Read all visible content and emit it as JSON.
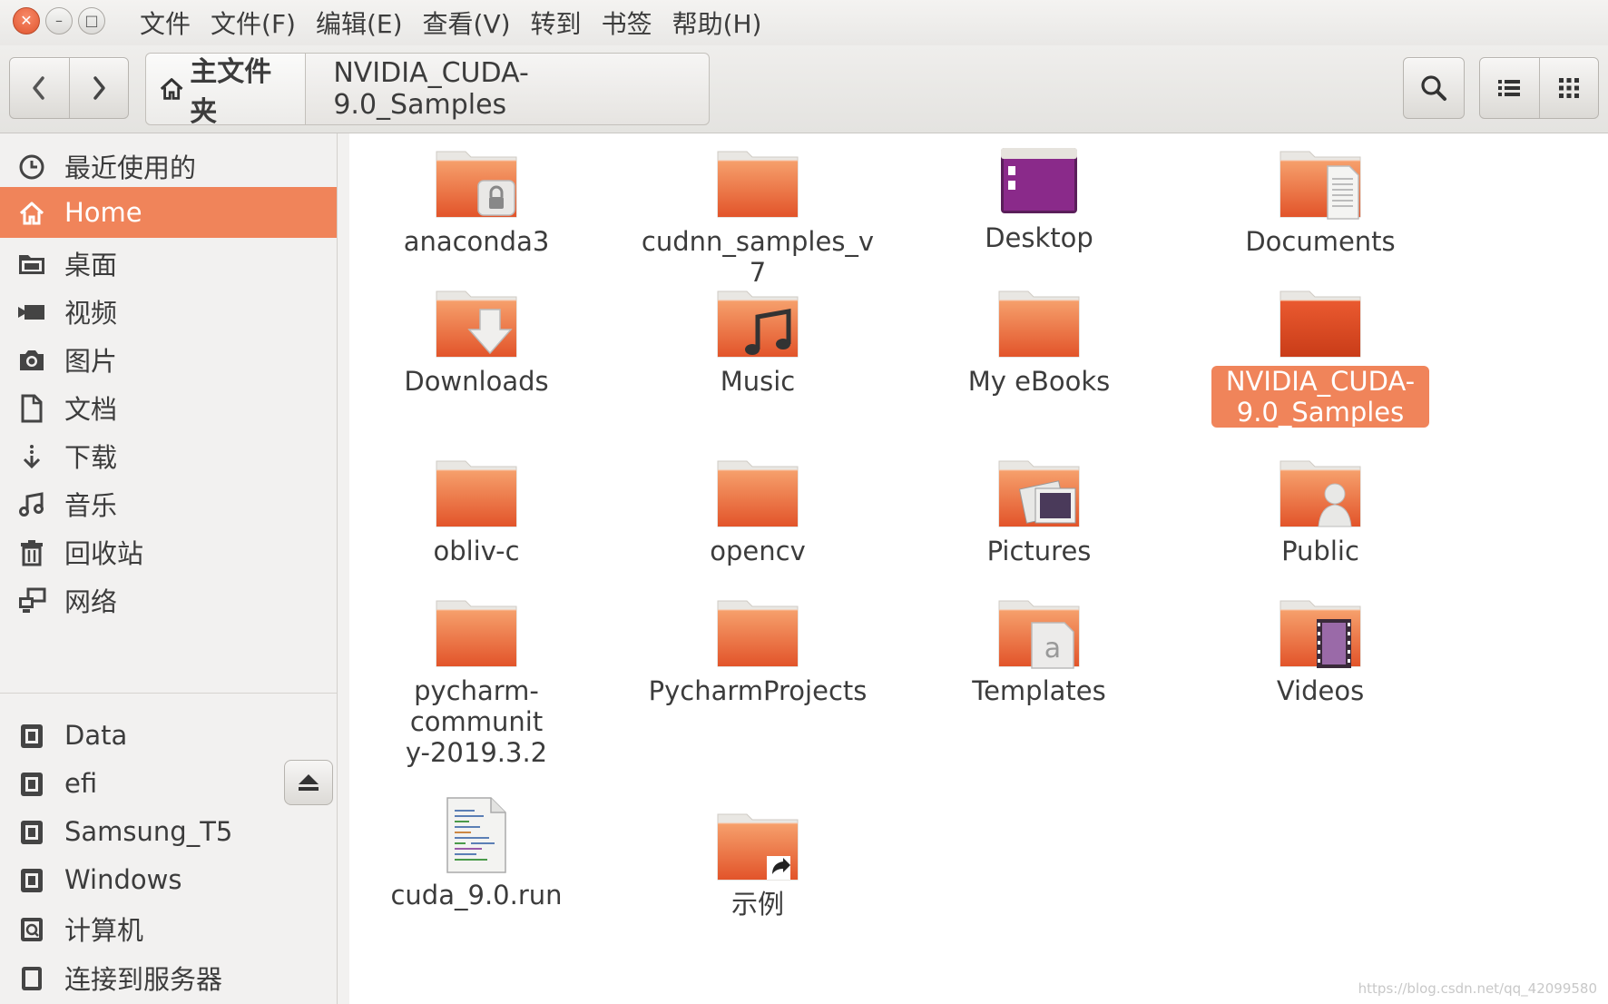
{
  "window": {
    "menus": [
      "文件",
      "文件(F)",
      "编辑(E)",
      "查看(V)",
      "转到",
      "书签",
      "帮助(H)"
    ]
  },
  "toolbar": {
    "breadcrumbs": [
      "主文件夹",
      "NVIDIA_CUDA-9.0_Samples"
    ]
  },
  "sidebar": {
    "places": [
      {
        "label": "最近使用的",
        "icon": "recent-clock-icon"
      },
      {
        "label": "Home",
        "icon": "home-icon",
        "active": true
      },
      {
        "label": "桌面",
        "icon": "desktop-folder-icon"
      },
      {
        "label": "视频",
        "icon": "video-camera-icon"
      },
      {
        "label": "图片",
        "icon": "camera-icon"
      },
      {
        "label": "文档",
        "icon": "document-icon"
      },
      {
        "label": "下载",
        "icon": "download-arrow-icon"
      },
      {
        "label": "音乐",
        "icon": "music-note-icon"
      },
      {
        "label": "回收站",
        "icon": "trash-icon"
      },
      {
        "label": "网络",
        "icon": "network-icon"
      }
    ],
    "devices": [
      {
        "label": "Data",
        "icon": "drive-icon"
      },
      {
        "label": "efi",
        "icon": "drive-icon"
      },
      {
        "label": "Samsung_T5",
        "icon": "drive-icon"
      },
      {
        "label": "Windows",
        "icon": "drive-icon"
      },
      {
        "label": "计算机",
        "icon": "computer-icon"
      },
      {
        "label": "连接到服务器",
        "icon": "server-icon"
      }
    ]
  },
  "files": [
    {
      "name": "anaconda3",
      "emblem": "lock"
    },
    {
      "name": "cudnn_samples_v7",
      "emblem": "none"
    },
    {
      "name": "Desktop",
      "emblem": "desktop"
    },
    {
      "name": "Documents",
      "emblem": "document"
    },
    {
      "name": "Downloads",
      "emblem": "download"
    },
    {
      "name": "Music",
      "emblem": "music"
    },
    {
      "name": "My eBooks",
      "emblem": "none"
    },
    {
      "name": "NVIDIA_CUDA-9.0_Samples",
      "emblem": "none",
      "selected": true
    },
    {
      "name": "obliv-c",
      "emblem": "none"
    },
    {
      "name": "opencv",
      "emblem": "none"
    },
    {
      "name": "Pictures",
      "emblem": "pictures"
    },
    {
      "name": "Public",
      "emblem": "public"
    },
    {
      "name": "pycharm-community-2019.3.2",
      "emblem": "none"
    },
    {
      "name": "PycharmProjects",
      "emblem": "none"
    },
    {
      "name": "Templates",
      "emblem": "templates"
    },
    {
      "name": "Videos",
      "emblem": "videos"
    },
    {
      "name": "cuda_9.0.run",
      "emblem": "file"
    },
    {
      "name": "示例",
      "emblem": "link"
    }
  ],
  "watermark": "https://blog.csdn.net/qq_42099580",
  "colors": {
    "accent": "#f0845a",
    "folder_top": "#f6a06c",
    "folder_bottom": "#e2542a"
  }
}
